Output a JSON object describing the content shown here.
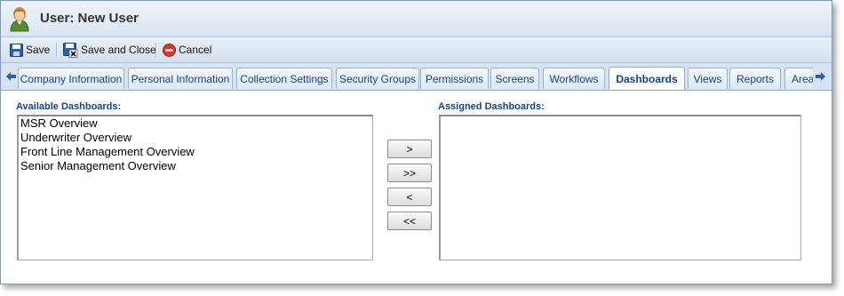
{
  "window": {
    "title": "User: New User"
  },
  "toolbar": {
    "save_label": "Save",
    "save_close_label": "Save and Close",
    "cancel_label": "Cancel"
  },
  "tabs": [
    {
      "label": "Company Information",
      "active": false
    },
    {
      "label": "Personal Information",
      "active": false
    },
    {
      "label": "Collection Settings",
      "active": false
    },
    {
      "label": "Security Groups",
      "active": false
    },
    {
      "label": "Permissions",
      "active": false
    },
    {
      "label": "Screens",
      "active": false
    },
    {
      "label": "Workflows",
      "active": false
    },
    {
      "label": "Dashboards",
      "active": true
    },
    {
      "label": "Views",
      "active": false
    },
    {
      "label": "Reports",
      "active": false
    },
    {
      "label": "Area",
      "active": false
    }
  ],
  "available": {
    "label": "Available Dashboards:",
    "items": [
      "MSR Overview",
      "Underwriter Overview",
      "Front Line Management Overview",
      "Senior Management Overview"
    ]
  },
  "assigned": {
    "label": "Assigned Dashboards:",
    "items": []
  },
  "move_buttons": {
    "add": ">",
    "add_all": ">>",
    "remove": "<",
    "remove_all": "<<"
  },
  "icons": {
    "avatar": "user-avatar-icon",
    "save": "floppy-disk-icon",
    "save_close": "floppy-disk-close-icon",
    "cancel": "cancel-circle-icon",
    "scroll_left": "arrow-left-icon",
    "scroll_right": "arrow-right-icon"
  },
  "colors": {
    "label_blue": "#15428b",
    "cancel_red": "#d9392b",
    "scroll_arrow": "#2b5fa8"
  }
}
